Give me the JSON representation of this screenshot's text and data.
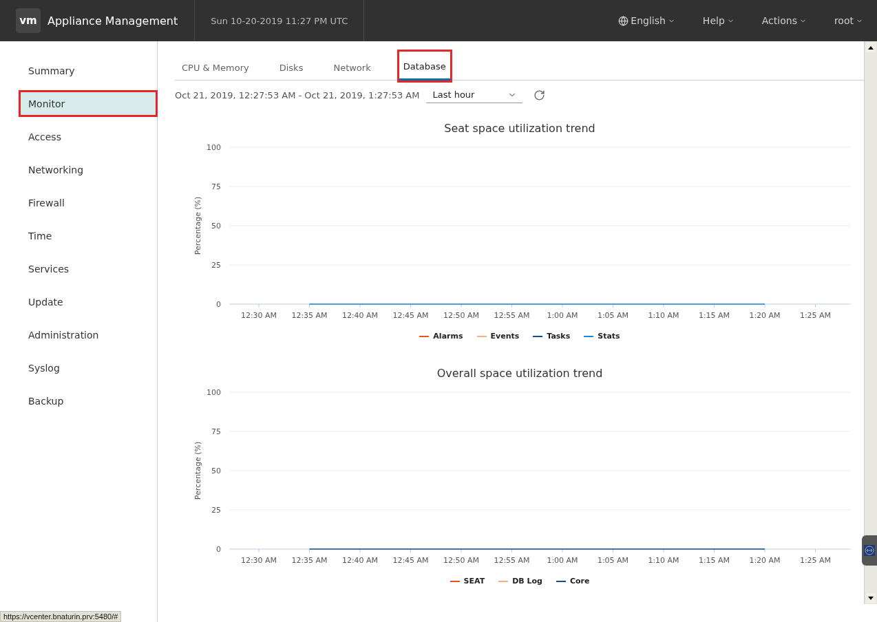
{
  "header": {
    "logo": "vm",
    "title": "Appliance Management",
    "datetime": "Sun 10-20-2019 11:27 PM UTC",
    "menus": [
      {
        "label": "English",
        "kind": "language"
      },
      {
        "label": "Help",
        "kind": "plain"
      },
      {
        "label": "Actions",
        "kind": "plain"
      },
      {
        "label": "root",
        "kind": "plain"
      }
    ]
  },
  "sidebar": {
    "items": [
      {
        "label": "Summary",
        "selected": false,
        "highlighted": false
      },
      {
        "label": "Monitor",
        "selected": true,
        "highlighted": true
      },
      {
        "label": "Access",
        "selected": false,
        "highlighted": false
      },
      {
        "label": "Networking",
        "selected": false,
        "highlighted": false
      },
      {
        "label": "Firewall",
        "selected": false,
        "highlighted": false
      },
      {
        "label": "Time",
        "selected": false,
        "highlighted": false
      },
      {
        "label": "Services",
        "selected": false,
        "highlighted": false
      },
      {
        "label": "Update",
        "selected": false,
        "highlighted": false
      },
      {
        "label": "Administration",
        "selected": false,
        "highlighted": false
      },
      {
        "label": "Syslog",
        "selected": false,
        "highlighted": false
      },
      {
        "label": "Backup",
        "selected": false,
        "highlighted": false
      }
    ]
  },
  "tabs": [
    {
      "label": "CPU & Memory",
      "selected": false,
      "highlighted": false
    },
    {
      "label": "Disks",
      "selected": false,
      "highlighted": false
    },
    {
      "label": "Network",
      "selected": false,
      "highlighted": false
    },
    {
      "label": "Database",
      "selected": true,
      "highlighted": true
    }
  ],
  "range": {
    "text": "Oct 21, 2019, 12:27:53 AM - Oct 21, 2019, 1:27:53 AM",
    "period": "Last hour"
  },
  "charts": [
    {
      "chart_data": {
        "type": "line",
        "title": "Seat space utilization trend",
        "ylabel": "Percentage (%)",
        "categories": [
          "12:30 AM",
          "12:35 AM",
          "12:40 AM",
          "12:45 AM",
          "12:50 AM",
          "12:55 AM",
          "1:00 AM",
          "1:05 AM",
          "1:10 AM",
          "1:15 AM",
          "1:20 AM",
          "1:25 AM"
        ],
        "ylim": [
          0,
          100
        ],
        "yticks": [
          0,
          25,
          50,
          75,
          100
        ],
        "grid": true,
        "series": [
          {
            "name": "Alarms",
            "color": "#f0501e",
            "values": [
              null,
              null,
              null,
              null,
              null,
              null,
              null,
              null,
              null,
              null,
              null,
              null
            ]
          },
          {
            "name": "Events",
            "color": "#f8b07c",
            "values": [
              null,
              null,
              null,
              null,
              null,
              null,
              null,
              null,
              null,
              null,
              null,
              null
            ]
          },
          {
            "name": "Tasks",
            "color": "#0e4c92",
            "values": [
              null,
              null,
              null,
              null,
              null,
              null,
              null,
              null,
              null,
              null,
              null,
              null
            ]
          },
          {
            "name": "Stats",
            "color": "#1a87d8",
            "values": [
              null,
              0,
              0,
              0,
              0,
              0,
              0,
              0,
              0,
              0,
              0,
              null
            ]
          }
        ]
      }
    },
    {
      "chart_data": {
        "type": "line",
        "title": "Overall space utilization trend",
        "ylabel": "Percentage (%)",
        "categories": [
          "12:30 AM",
          "12:35 AM",
          "12:40 AM",
          "12:45 AM",
          "12:50 AM",
          "12:55 AM",
          "1:00 AM",
          "1:05 AM",
          "1:10 AM",
          "1:15 AM",
          "1:20 AM",
          "1:25 AM"
        ],
        "ylim": [
          0,
          100
        ],
        "yticks": [
          0,
          25,
          50,
          75,
          100
        ],
        "grid": true,
        "series": [
          {
            "name": "SEAT",
            "color": "#f0501e",
            "values": [
              null,
              null,
              null,
              null,
              null,
              null,
              null,
              null,
              null,
              null,
              null,
              null
            ]
          },
          {
            "name": "DB Log",
            "color": "#f8b07c",
            "values": [
              null,
              null,
              null,
              null,
              null,
              null,
              null,
              null,
              null,
              null,
              null,
              null
            ]
          },
          {
            "name": "Core",
            "color": "#0e4c92",
            "values": [
              null,
              0,
              0,
              0,
              0,
              0,
              0,
              0,
              0,
              0,
              0,
              null
            ]
          }
        ]
      }
    }
  ],
  "status_bar": {
    "url": "https://vcenter.bnaturin.prv:5480/#"
  }
}
